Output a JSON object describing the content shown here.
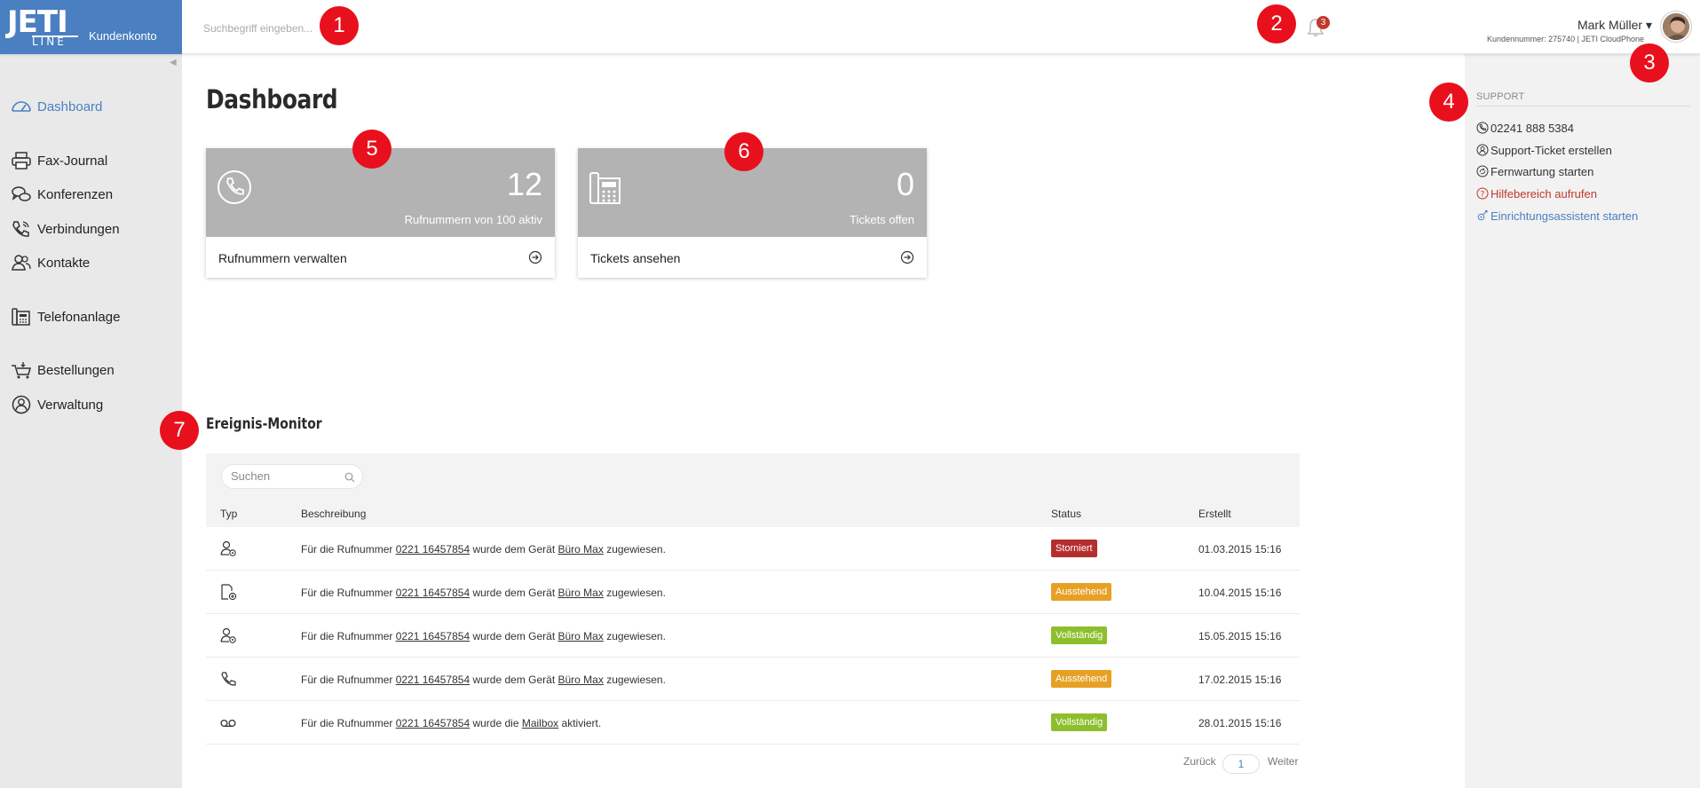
{
  "app": {
    "logo_top": "JETI",
    "logo_bottom": "LINE",
    "label": "Kundenkonto"
  },
  "header": {
    "search_placeholder": "Suchbegriff eingeben...",
    "notification_count": "3",
    "user_name": "Mark Müller ▾",
    "user_sub": "Kundennummer: 275740 | JETI CloudPhone"
  },
  "sidebar": {
    "items": [
      {
        "label": "Dashboard",
        "icon": "dashboard-icon",
        "active": true
      },
      {
        "label": "Fax-Journal",
        "icon": "printer-icon"
      },
      {
        "label": "Konferenzen",
        "icon": "chat-bubbles-icon"
      },
      {
        "label": "Verbindungen",
        "icon": "phone-call-icon"
      },
      {
        "label": "Kontakte",
        "icon": "contacts-icon"
      },
      {
        "label": "Telefonanlage",
        "icon": "desk-phone-icon"
      },
      {
        "label": "Bestellungen",
        "icon": "shopping-cart-icon"
      },
      {
        "label": "Verwaltung",
        "icon": "user-circle-icon"
      }
    ]
  },
  "main": {
    "title": "Dashboard",
    "cards": [
      {
        "number": "12",
        "description": "Rufnummern von 100 aktiv",
        "link": "Rufnummern verwalten",
        "icon": "phone-handset-icon"
      },
      {
        "number": "0",
        "description": "Tickets offen",
        "link": "Tickets ansehen",
        "icon": "desk-phone-icon"
      }
    ],
    "monitor": {
      "title": "Ereignis-Monitor",
      "search_placeholder": "Suchen",
      "columns": [
        "Typ",
        "Beschreibung",
        "Status",
        "Erstellt"
      ],
      "rows": [
        {
          "icon": "user-settings-icon",
          "pre": "Für die Rufnummer ",
          "number": "0221 16457854",
          "mid": " wurde dem Gerät ",
          "target": "Büro Max",
          "post": " zugewiesen.",
          "status": "Storniert",
          "created": "01.03.2015 15:16"
        },
        {
          "icon": "document-add-icon",
          "pre": "Für die Rufnummer ",
          "number": "0221 16457854",
          "mid": " wurde dem Gerät ",
          "target": "Büro Max",
          "post": " zugewiesen.",
          "status": "Ausstehend",
          "created": "10.04.2015 15:16"
        },
        {
          "icon": "user-settings-icon",
          "pre": "Für die Rufnummer ",
          "number": "0221 16457854",
          "mid": " wurde dem Gerät ",
          "target": "Büro Max",
          "post": " zugewiesen.",
          "status": "Vollständig",
          "created": "15.05.2015 15:16"
        },
        {
          "icon": "phone-handset-icon",
          "pre": "Für die Rufnummer ",
          "number": "0221 16457854",
          "mid": " wurde dem Gerät ",
          "target": "Büro Max",
          "post": " zugewiesen.",
          "status": "Ausstehend",
          "created": "17.02.2015 15:16"
        },
        {
          "icon": "voicemail-icon",
          "pre": "Für die Rufnummer ",
          "number": "0221 16457854",
          "mid": " wurde die ",
          "target": "Mailbox",
          "post": " aktiviert.",
          "status": "Vollständig",
          "created": "28.01.2015 15:16"
        }
      ],
      "pager": {
        "prev": "Zurück",
        "page": "1",
        "next": "Weiter"
      }
    }
  },
  "support": {
    "title": "SUPPORT",
    "items": [
      {
        "label": "02241 888 5384",
        "icon": "phone-icon"
      },
      {
        "label": "Support-Ticket erstellen",
        "icon": "support-ticket-icon"
      },
      {
        "label": "Fernwartung starten",
        "icon": "remote-icon"
      },
      {
        "label": "Hilfebereich aufrufen",
        "icon": "help-icon"
      },
      {
        "label": "Einrichtungsassistent starten",
        "icon": "wizard-icon"
      }
    ]
  },
  "markers": [
    "1",
    "2",
    "3",
    "4",
    "5",
    "6",
    "7"
  ],
  "colors": {
    "brand": "#4a7fc1",
    "card_bg": "#b3b3b3",
    "marker": "#e8101c",
    "status_storniert": "#b52e2e",
    "status_ausstehend": "#e6a125",
    "status_vollstaendig": "#8dbf2c",
    "help_link": "#c0392b",
    "wizard_link": "#4a7fc1"
  }
}
